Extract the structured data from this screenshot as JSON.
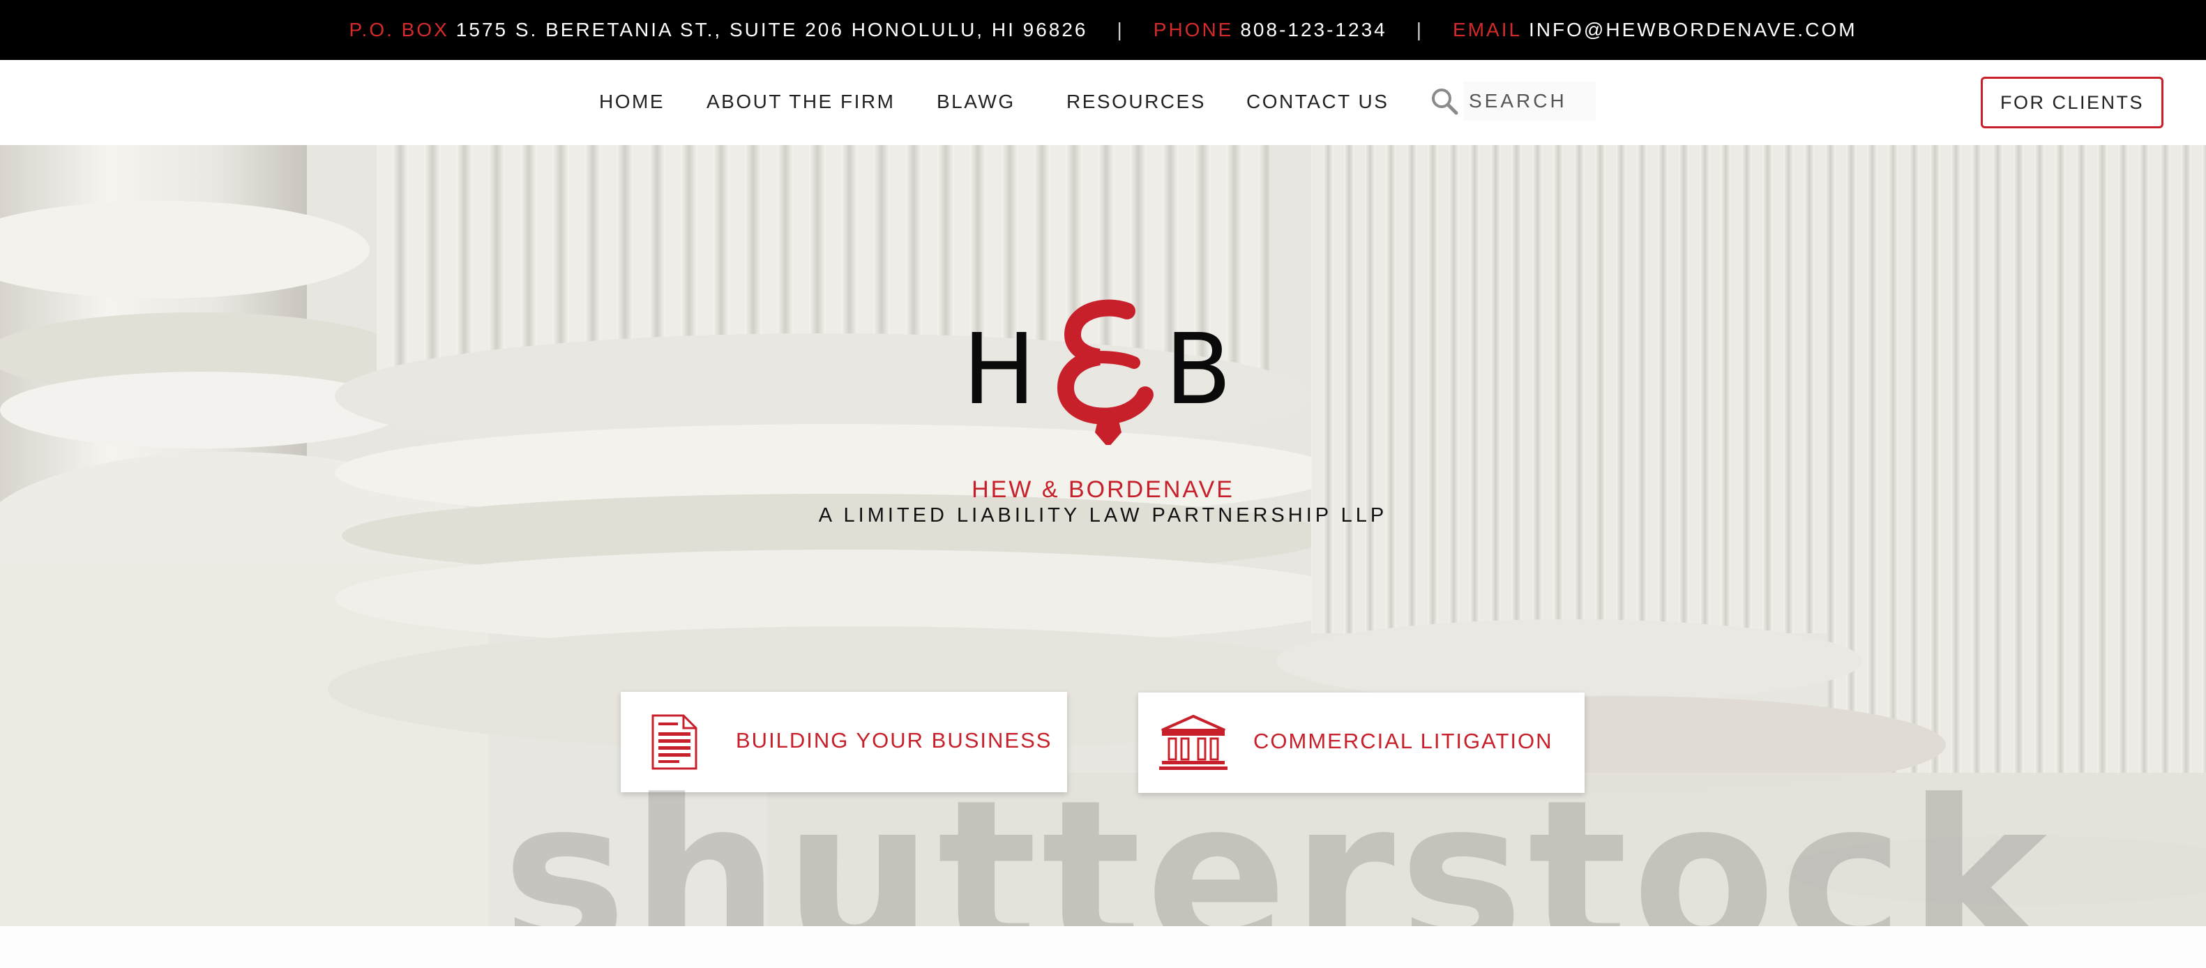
{
  "topbar": {
    "pobox_label": "P.O. BOX",
    "pobox_value": "1575 S. BERETANIA ST., SUITE 206 HONOLULU, HI 96826",
    "separator": "|",
    "phone_label": "PHONE",
    "phone_value": "808-123-1234",
    "email_label": "EMAIL",
    "email_value": "INFO@HEWBORDENAVE.COM"
  },
  "nav": {
    "items": [
      "HOME",
      "ABOUT THE FIRM",
      "BLAWG",
      "RESOURCES",
      "CONTACT US"
    ],
    "search_placeholder": "SEARCH",
    "for_clients": "FOR CLIENTS"
  },
  "hero": {
    "logo_text": "H&B",
    "firm_name": "HEW & BORDENAVE",
    "firm_tagline": "A LIMITED LIABILITY LAW PARTNERSHIP LLP",
    "watermark": "shutterstock",
    "cards": [
      {
        "label": "BUILDING YOUR BUSINESS",
        "icon": "document-icon"
      },
      {
        "label": "COMMERCIAL LITIGATION",
        "icon": "courthouse-icon"
      }
    ]
  },
  "colors": {
    "accent": "#c8202a",
    "topbar_bg": "#000000",
    "nav_text": "#222222"
  }
}
